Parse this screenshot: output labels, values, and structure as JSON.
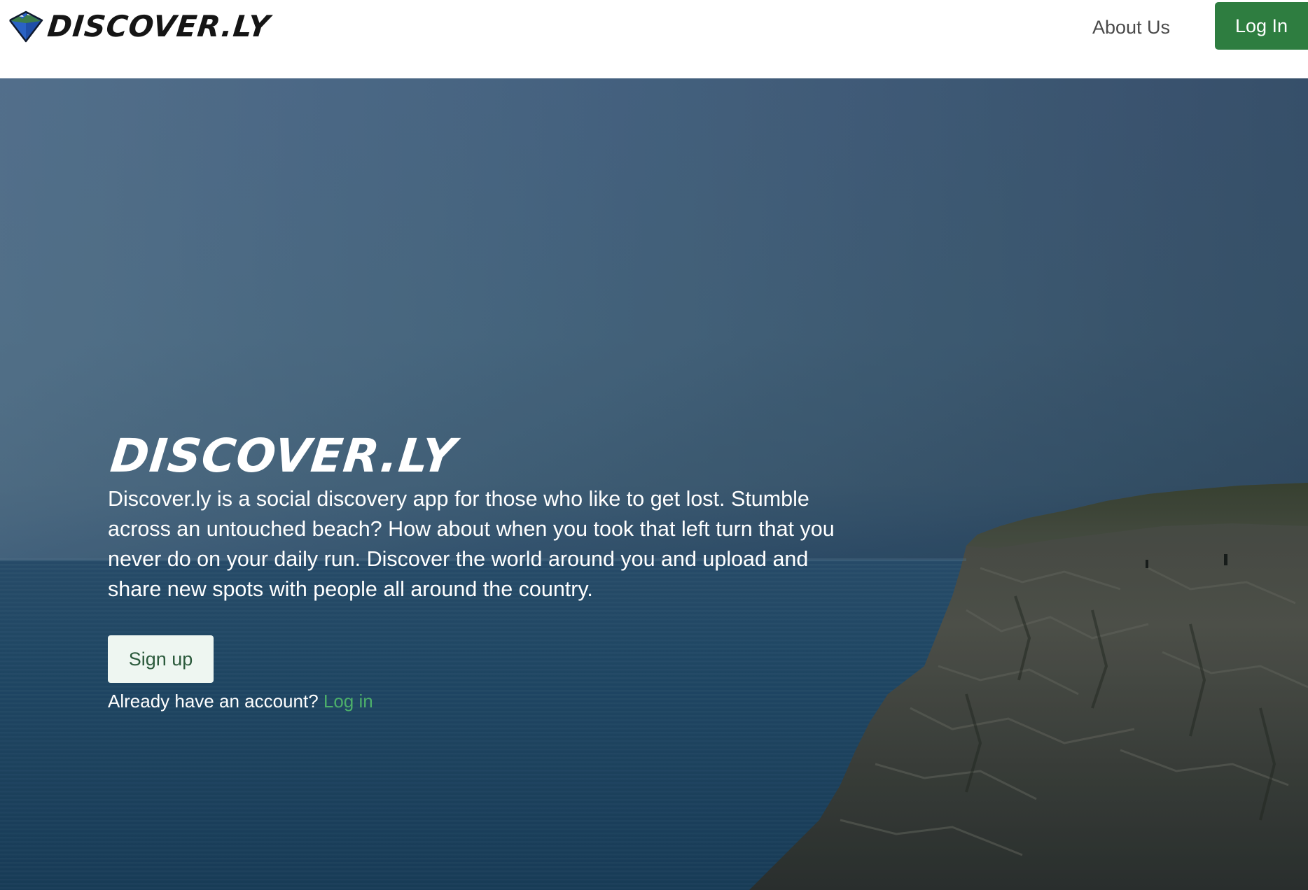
{
  "navbar": {
    "brand_name": "DISCOVER.LY",
    "about_label": "About Us",
    "login_label": "Log In",
    "login_color": "#2e7d40"
  },
  "hero": {
    "title": "DISCOVER.LY",
    "description": "Discover.ly is a social discovery app for those who like to get lost. Stumble across an untouched beach? How about when you took that left turn that you never do on your daily run. Discover the world around you and upload and share new spots with people all around the country.",
    "signup_label": "Sign up",
    "already_text": "Already have an account?",
    "login_link_label": "Log in",
    "link_color": "#4caf6a"
  },
  "icons": {
    "logo": "mountain-diamond-logo-icon"
  }
}
